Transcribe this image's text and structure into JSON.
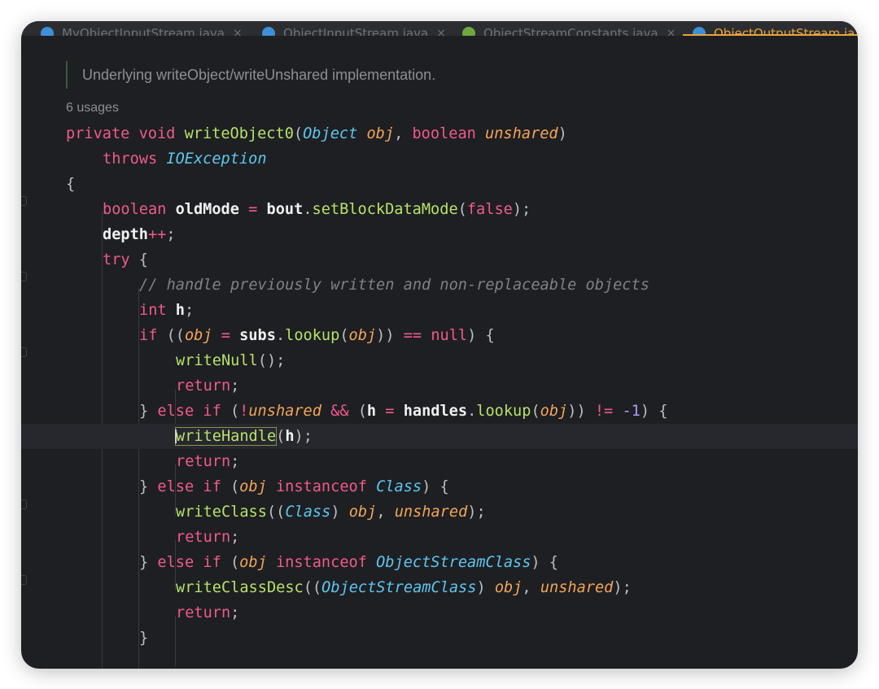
{
  "tabs": [
    {
      "label": "MyObjectInputStream.java",
      "icon_color": "#3d8fd6",
      "active": false
    },
    {
      "label": "ObjectInputStream.java",
      "icon_color": "#3d8fd6",
      "active": false
    },
    {
      "label": "ObjectStreamConstants.java",
      "icon_color": "#6fa83f",
      "active": false
    },
    {
      "label": "ObjectOutputStream.ja",
      "icon_color": "#3d8fd6",
      "active": true
    }
  ],
  "tab_close_glyph": "×",
  "doc_comment": "Underlying writeObject/writeUnshared implementation.",
  "usages": "6 usages",
  "code": {
    "l1": [
      "private",
      " ",
      "void",
      " ",
      "writeObject0",
      "(",
      "Object",
      " ",
      "obj",
      ", ",
      "boolean",
      " ",
      "unshared",
      ")"
    ],
    "l2": [
      "throws",
      " ",
      "IOException"
    ],
    "l3": [
      "{"
    ],
    "l4": [
      "boolean",
      " ",
      "oldMode",
      " = ",
      "bout",
      ".",
      "setBlockDataMode",
      "(",
      "false",
      ");"
    ],
    "l5": [
      "depth",
      "++",
      ";"
    ],
    "l6": [
      "try",
      " {"
    ],
    "l7": [
      "// handle previously written and non-replaceable objects"
    ],
    "l8": [
      "int",
      " ",
      "h",
      ";"
    ],
    "l9": [
      "if",
      " ((",
      "obj",
      " = ",
      "subs",
      ".",
      "lookup",
      "(",
      "obj",
      ")) ",
      "==",
      " ",
      "null",
      ") {"
    ],
    "l10": [
      "writeNull",
      "();"
    ],
    "l11": [
      "return",
      ";"
    ],
    "l12": [
      "} ",
      "else",
      " ",
      "if",
      " (",
      "!",
      "unshared",
      " ",
      "&&",
      " (",
      "h",
      " = ",
      "handles",
      ".",
      "lookup",
      "(",
      "obj",
      ")) ",
      "!=",
      " ",
      "-1",
      ") {"
    ],
    "l13": [
      "writeHandle",
      "(",
      "h",
      ");"
    ],
    "l14": [
      "return",
      ";"
    ],
    "l15": [
      "} ",
      "else",
      " ",
      "if",
      " (",
      "obj",
      " ",
      "instanceof",
      " ",
      "Class",
      ") {"
    ],
    "l16": [
      "writeClass",
      "((",
      "Class",
      ") ",
      "obj",
      ", ",
      "unshared",
      ");"
    ],
    "l17": [
      "return",
      ";"
    ],
    "l18": [
      "} ",
      "else",
      " ",
      "if",
      " (",
      "obj",
      " ",
      "instanceof",
      " ",
      "ObjectStreamClass",
      ") {"
    ],
    "l19": [
      "writeClassDesc",
      "((",
      "ObjectStreamClass",
      ") ",
      "obj",
      ", ",
      "unshared",
      ");"
    ],
    "l20": [
      "return",
      ";"
    ],
    "l21": [
      "}"
    ]
  },
  "colors": {
    "background": "#1e1f22",
    "keyword": "#ef5a8d",
    "function": "#b7e26a",
    "type": "#5ec7f0",
    "parameter": "#f2a65a",
    "comment": "#7e8287",
    "number": "#ae9cf7",
    "active_tab": "#e8a33d"
  }
}
